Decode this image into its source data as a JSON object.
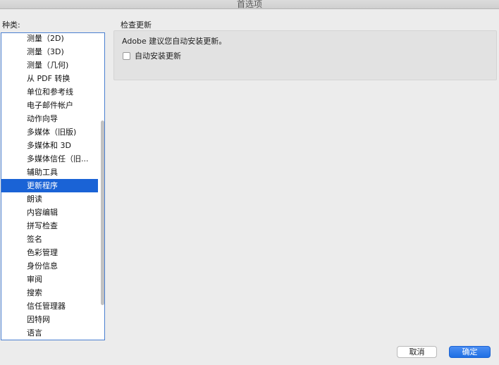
{
  "window": {
    "title": "首选项"
  },
  "categories": {
    "label": "种类:",
    "items": [
      {
        "label": "测量（2D)"
      },
      {
        "label": "测量（3D)"
      },
      {
        "label": "测量（几何)"
      },
      {
        "label": "从 PDF 转换"
      },
      {
        "label": "单位和参考线"
      },
      {
        "label": "电子邮件帐户"
      },
      {
        "label": "动作向导"
      },
      {
        "label": "多媒体（旧版)"
      },
      {
        "label": "多媒体和 3D"
      },
      {
        "label": "多媒体信任（旧..."
      },
      {
        "label": "辅助工具"
      },
      {
        "label": "更新程序",
        "selected": true
      },
      {
        "label": "朗读"
      },
      {
        "label": "内容编辑"
      },
      {
        "label": "拼写检查"
      },
      {
        "label": "签名"
      },
      {
        "label": "色彩管理"
      },
      {
        "label": "身份信息"
      },
      {
        "label": "审阅"
      },
      {
        "label": "搜索"
      },
      {
        "label": "信任管理器"
      },
      {
        "label": "因特网"
      },
      {
        "label": "语言"
      }
    ]
  },
  "section": {
    "title": "检查更新",
    "description": "Adobe 建议您自动安装更新。",
    "auto_install": {
      "label": "自动安装更新",
      "checked": false
    }
  },
  "buttons": {
    "cancel": "取消",
    "ok": "确定"
  },
  "colors": {
    "selection": "#1a63d6",
    "list_border": "#4a7fd0",
    "primary_button": "#1f6fe3"
  }
}
